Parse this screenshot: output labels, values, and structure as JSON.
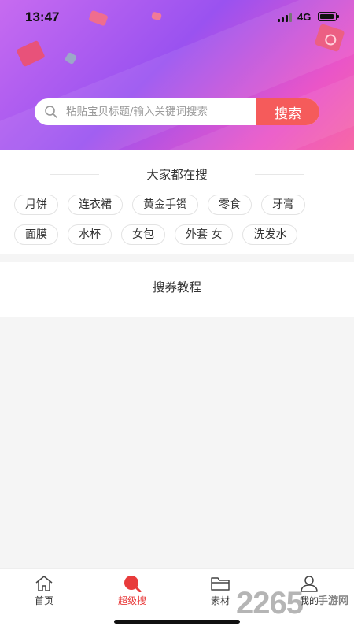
{
  "status_bar": {
    "time": "13:47",
    "network": "4G"
  },
  "search": {
    "placeholder": "粘贴宝贝标题/输入关键词搜索",
    "button_label": "搜索"
  },
  "hot_searches": {
    "title": "大家都在搜",
    "rows": [
      [
        "月饼",
        "连衣裙",
        "黄金手镯",
        "零食",
        "牙膏"
      ],
      [
        "面膜",
        "水杯",
        "女包",
        "外套 女",
        "洗发水"
      ]
    ]
  },
  "tutorial": {
    "title": "搜券教程"
  },
  "tabbar": {
    "items": [
      {
        "label": "首页",
        "icon": "home-icon",
        "active": false
      },
      {
        "label": "超级搜",
        "icon": "search-icon",
        "active": true
      },
      {
        "label": "素材",
        "icon": "folder-icon",
        "active": false
      },
      {
        "label": "我的",
        "icon": "user-icon",
        "active": false
      }
    ]
  },
  "watermark": {
    "number": "2265",
    "text": "手游网"
  },
  "colors": {
    "accent": "#f55b5b",
    "active_tab": "#e83b3b",
    "header_start": "#c76bf0",
    "header_end": "#f768a6"
  }
}
